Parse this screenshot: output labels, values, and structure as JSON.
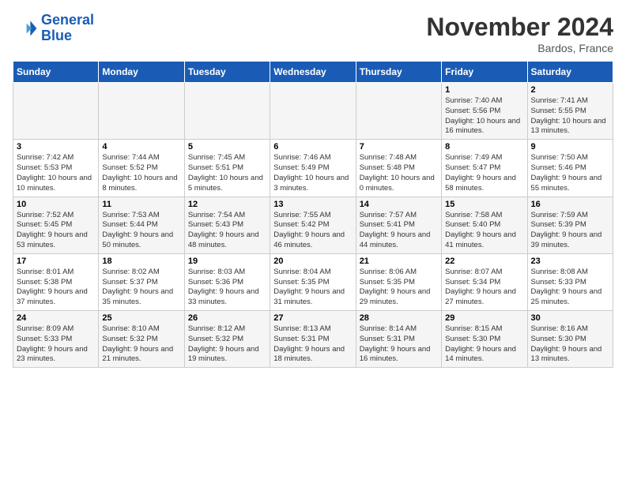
{
  "header": {
    "logo_line1": "General",
    "logo_line2": "Blue",
    "month": "November 2024",
    "location": "Bardos, France"
  },
  "days_of_week": [
    "Sunday",
    "Monday",
    "Tuesday",
    "Wednesday",
    "Thursday",
    "Friday",
    "Saturday"
  ],
  "weeks": [
    [
      {
        "day": "",
        "info": ""
      },
      {
        "day": "",
        "info": ""
      },
      {
        "day": "",
        "info": ""
      },
      {
        "day": "",
        "info": ""
      },
      {
        "day": "",
        "info": ""
      },
      {
        "day": "1",
        "info": "Sunrise: 7:40 AM\nSunset: 5:56 PM\nDaylight: 10 hours and 16 minutes."
      },
      {
        "day": "2",
        "info": "Sunrise: 7:41 AM\nSunset: 5:55 PM\nDaylight: 10 hours and 13 minutes."
      }
    ],
    [
      {
        "day": "3",
        "info": "Sunrise: 7:42 AM\nSunset: 5:53 PM\nDaylight: 10 hours and 10 minutes."
      },
      {
        "day": "4",
        "info": "Sunrise: 7:44 AM\nSunset: 5:52 PM\nDaylight: 10 hours and 8 minutes."
      },
      {
        "day": "5",
        "info": "Sunrise: 7:45 AM\nSunset: 5:51 PM\nDaylight: 10 hours and 5 minutes."
      },
      {
        "day": "6",
        "info": "Sunrise: 7:46 AM\nSunset: 5:49 PM\nDaylight: 10 hours and 3 minutes."
      },
      {
        "day": "7",
        "info": "Sunrise: 7:48 AM\nSunset: 5:48 PM\nDaylight: 10 hours and 0 minutes."
      },
      {
        "day": "8",
        "info": "Sunrise: 7:49 AM\nSunset: 5:47 PM\nDaylight: 9 hours and 58 minutes."
      },
      {
        "day": "9",
        "info": "Sunrise: 7:50 AM\nSunset: 5:46 PM\nDaylight: 9 hours and 55 minutes."
      }
    ],
    [
      {
        "day": "10",
        "info": "Sunrise: 7:52 AM\nSunset: 5:45 PM\nDaylight: 9 hours and 53 minutes."
      },
      {
        "day": "11",
        "info": "Sunrise: 7:53 AM\nSunset: 5:44 PM\nDaylight: 9 hours and 50 minutes."
      },
      {
        "day": "12",
        "info": "Sunrise: 7:54 AM\nSunset: 5:43 PM\nDaylight: 9 hours and 48 minutes."
      },
      {
        "day": "13",
        "info": "Sunrise: 7:55 AM\nSunset: 5:42 PM\nDaylight: 9 hours and 46 minutes."
      },
      {
        "day": "14",
        "info": "Sunrise: 7:57 AM\nSunset: 5:41 PM\nDaylight: 9 hours and 44 minutes."
      },
      {
        "day": "15",
        "info": "Sunrise: 7:58 AM\nSunset: 5:40 PM\nDaylight: 9 hours and 41 minutes."
      },
      {
        "day": "16",
        "info": "Sunrise: 7:59 AM\nSunset: 5:39 PM\nDaylight: 9 hours and 39 minutes."
      }
    ],
    [
      {
        "day": "17",
        "info": "Sunrise: 8:01 AM\nSunset: 5:38 PM\nDaylight: 9 hours and 37 minutes."
      },
      {
        "day": "18",
        "info": "Sunrise: 8:02 AM\nSunset: 5:37 PM\nDaylight: 9 hours and 35 minutes."
      },
      {
        "day": "19",
        "info": "Sunrise: 8:03 AM\nSunset: 5:36 PM\nDaylight: 9 hours and 33 minutes."
      },
      {
        "day": "20",
        "info": "Sunrise: 8:04 AM\nSunset: 5:35 PM\nDaylight: 9 hours and 31 minutes."
      },
      {
        "day": "21",
        "info": "Sunrise: 8:06 AM\nSunset: 5:35 PM\nDaylight: 9 hours and 29 minutes."
      },
      {
        "day": "22",
        "info": "Sunrise: 8:07 AM\nSunset: 5:34 PM\nDaylight: 9 hours and 27 minutes."
      },
      {
        "day": "23",
        "info": "Sunrise: 8:08 AM\nSunset: 5:33 PM\nDaylight: 9 hours and 25 minutes."
      }
    ],
    [
      {
        "day": "24",
        "info": "Sunrise: 8:09 AM\nSunset: 5:33 PM\nDaylight: 9 hours and 23 minutes."
      },
      {
        "day": "25",
        "info": "Sunrise: 8:10 AM\nSunset: 5:32 PM\nDaylight: 9 hours and 21 minutes."
      },
      {
        "day": "26",
        "info": "Sunrise: 8:12 AM\nSunset: 5:32 PM\nDaylight: 9 hours and 19 minutes."
      },
      {
        "day": "27",
        "info": "Sunrise: 8:13 AM\nSunset: 5:31 PM\nDaylight: 9 hours and 18 minutes."
      },
      {
        "day": "28",
        "info": "Sunrise: 8:14 AM\nSunset: 5:31 PM\nDaylight: 9 hours and 16 minutes."
      },
      {
        "day": "29",
        "info": "Sunrise: 8:15 AM\nSunset: 5:30 PM\nDaylight: 9 hours and 14 minutes."
      },
      {
        "day": "30",
        "info": "Sunrise: 8:16 AM\nSunset: 5:30 PM\nDaylight: 9 hours and 13 minutes."
      }
    ]
  ]
}
